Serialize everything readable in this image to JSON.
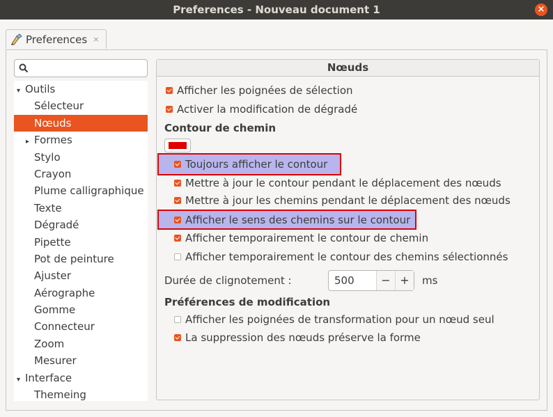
{
  "window": {
    "title": "Preferences - Nouveau document 1",
    "close_glyph": "×"
  },
  "tab": {
    "label": "Preferences",
    "close_glyph": "×"
  },
  "tree": {
    "items": [
      {
        "label": "Outils",
        "level": 0,
        "expander": "▾"
      },
      {
        "label": "Sélecteur",
        "level": 1
      },
      {
        "label": "Nœuds",
        "level": 1,
        "selected": true
      },
      {
        "label": "Formes",
        "level": 1,
        "expander": "▸"
      },
      {
        "label": "Stylo",
        "level": 1
      },
      {
        "label": "Crayon",
        "level": 1
      },
      {
        "label": "Plume calligraphique",
        "level": 1
      },
      {
        "label": "Texte",
        "level": 1
      },
      {
        "label": "Dégradé",
        "level": 1
      },
      {
        "label": "Pipette",
        "level": 1
      },
      {
        "label": "Pot de peinture",
        "level": 1
      },
      {
        "label": "Ajuster",
        "level": 1
      },
      {
        "label": "Aérographe",
        "level": 1
      },
      {
        "label": "Gomme",
        "level": 1
      },
      {
        "label": "Connecteur",
        "level": 1
      },
      {
        "label": "Zoom",
        "level": 1
      },
      {
        "label": "Mesurer",
        "level": 1
      },
      {
        "label": "Interface",
        "level": 0,
        "expander": "▾"
      },
      {
        "label": "Themeing",
        "level": 1
      }
    ]
  },
  "panel": {
    "title": "Nœuds",
    "options": [
      {
        "label": "Afficher les poignées de sélection",
        "checked": true
      },
      {
        "label": "Activer la modification de dégradé",
        "checked": true
      }
    ],
    "path_section": "Contour de chemin",
    "path_color": "#e00000",
    "path_options": [
      {
        "label": "Toujours afficher le contour",
        "checked": true,
        "highlighted": true
      },
      {
        "label": "Mettre à jour le contour pendant le déplacement des nœuds",
        "checked": true
      },
      {
        "label": "Mettre à jour les chemins pendant le déplacement des nœuds",
        "checked": true
      },
      {
        "label": "Afficher le sens des chemins sur le contour",
        "checked": true,
        "highlighted": true
      },
      {
        "label": "Afficher temporairement le contour de chemin",
        "checked": true
      },
      {
        "label": "Afficher temporairement le contour des chemins sélectionnés",
        "checked": false
      }
    ],
    "blink": {
      "label": "Durée de clignotement :",
      "value": "500",
      "minus": "−",
      "plus": "+",
      "unit": "ms"
    },
    "edit_section": "Préférences de modification",
    "edit_options": [
      {
        "label": "Afficher les poignées de transformation pour un nœud seul",
        "checked": false
      },
      {
        "label": "La suppression des nœuds préserve la forme",
        "checked": true
      }
    ]
  },
  "colors": {
    "accent": "#e95420",
    "highlight_fill": "#b8b5ee",
    "highlight_border": "#e00000"
  }
}
